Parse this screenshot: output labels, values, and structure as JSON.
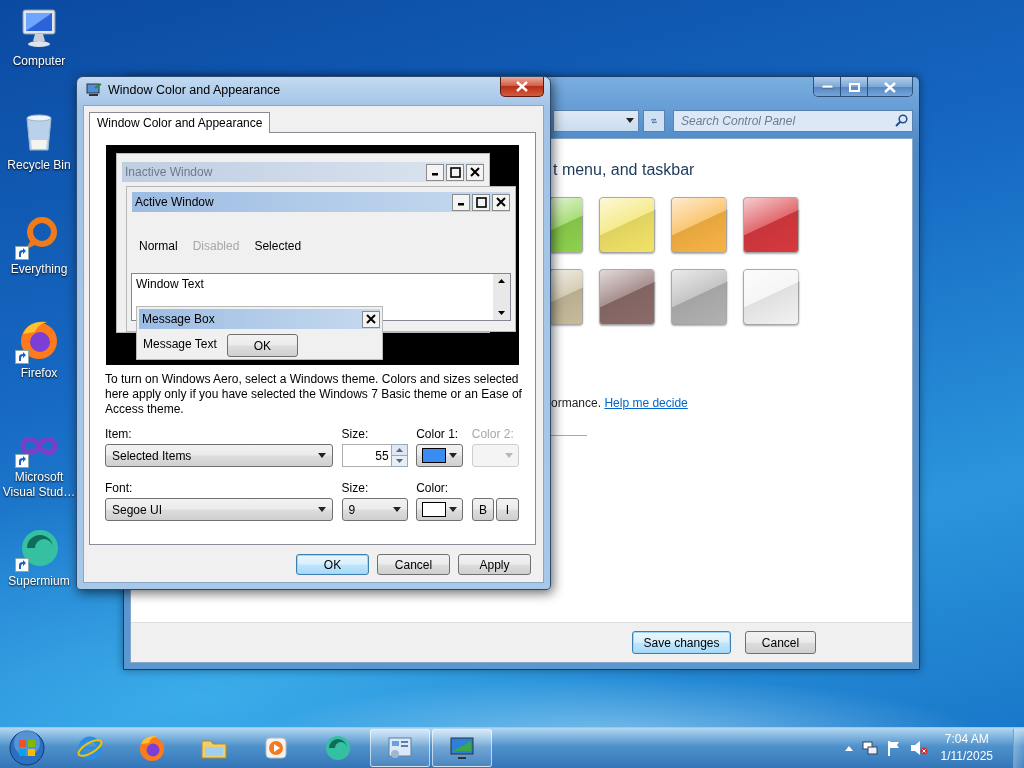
{
  "desktop_icons": [
    {
      "label": "Computer",
      "kind": "computer",
      "shortcut": false
    },
    {
      "label": "Recycle Bin",
      "kind": "recycle-bin",
      "shortcut": false
    },
    {
      "label": "Everything",
      "kind": "everything",
      "shortcut": true
    },
    {
      "label": "Firefox",
      "kind": "firefox",
      "shortcut": true
    },
    {
      "label": "Microsoft Visual Stud…",
      "kind": "visual-studio",
      "shortcut": true
    },
    {
      "label": "Supermium",
      "kind": "supermium",
      "shortcut": true
    }
  ],
  "control_panel": {
    "search": {
      "placeholder": "Search Control Panel"
    },
    "heading": "t menu, and taskbar",
    "swatches": [
      {
        "color": "#8ed24e"
      },
      {
        "color": "#f3e468"
      },
      {
        "color": "#f9b445"
      },
      {
        "color": "#d8393f"
      },
      {
        "color": "#c8bc9c"
      },
      {
        "color": "#8c6c6a"
      },
      {
        "color": "#b2b2b2"
      },
      {
        "color": "#f3f3f3"
      }
    ],
    "text": "ormance.",
    "link": "Help me decide",
    "buttons": [
      {
        "label": "Save changes",
        "default": true
      },
      {
        "label": "Cancel",
        "default": false
      }
    ]
  },
  "dialog": {
    "title": "Window Color and Appearance",
    "tabs": [
      {
        "label": "Window Color and Appearance",
        "selected": true
      }
    ],
    "preview": {
      "inactive_title": "Inactive Window",
      "active_title": "Active Window",
      "menu_items": [
        {
          "label": "Normal",
          "disabled": false
        },
        {
          "label": "Disabled",
          "disabled": true
        },
        {
          "label": "Selected",
          "disabled": false
        }
      ],
      "window_text": "Window Text",
      "message_title": "Message Box",
      "message_text": "Message Text",
      "message_button": "OK"
    },
    "note": "To turn on Windows Aero, select a Windows theme.  Colors and sizes selected here apply only if you have selected the Windows 7 Basic theme or an Ease of Access theme.",
    "item": {
      "label": "Item:",
      "value": "Selected Items"
    },
    "item_size": {
      "label": "Size:",
      "value": "55"
    },
    "color_1": {
      "label": "Color 1:",
      "color": "#3a8cf2",
      "disabled": false
    },
    "color_2": {
      "label": "Color 2:",
      "disabled": true
    },
    "font": {
      "label": "Font:",
      "value": "Segoe UI"
    },
    "font_size": {
      "label": "Size:",
      "value": "9"
    },
    "font_color": {
      "label": "Color:",
      "color": "#ffffff",
      "disabled": false
    },
    "bold_button": {
      "label": "B"
    },
    "italic_button": {
      "label": "I"
    },
    "buttons": [
      {
        "label": "OK",
        "default": true
      },
      {
        "label": "Cancel",
        "default": false
      },
      {
        "label": "Apply",
        "default": false
      }
    ]
  },
  "taskbar": {
    "items": [
      {
        "kind": "internet-explorer",
        "active": false
      },
      {
        "kind": "firefox",
        "active": false
      },
      {
        "kind": "file-explorer",
        "active": false
      },
      {
        "kind": "media-player",
        "active": false
      },
      {
        "kind": "supermium",
        "active": false
      },
      {
        "kind": "control-panel",
        "active": true
      },
      {
        "kind": "display",
        "active": true
      }
    ],
    "clock": {
      "time": "7:04 AM",
      "date": "1/11/2025"
    }
  }
}
